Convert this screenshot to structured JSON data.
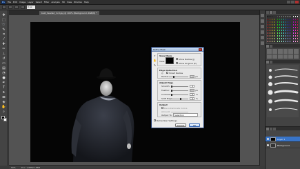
{
  "menubar": {
    "logo": "Ps",
    "items": [
      "File",
      "Edit",
      "Image",
      "Layer",
      "Select",
      "Filter",
      "Analysis",
      "3D",
      "View",
      "Window",
      "Help"
    ]
  },
  "options": {
    "field_value": "0 px"
  },
  "document": {
    "tab_label": "bald_headed_m-8.jpg @ 100% (Background, RGB/8) *"
  },
  "status": {
    "zoom": "50%",
    "doc_size": "Doc: 1.83M/1.83M"
  },
  "dialog": {
    "title": "Refine Mask",
    "view_mode": "View Mode",
    "view_label": "View:",
    "show_radius": "Show Radius (J)",
    "show_original": "Show Original (P)",
    "edge_detection": "Edge Detection",
    "smart_radius": "Smart Radius",
    "radius_label": "Radius:",
    "radius_value": "1.0",
    "radius_unit": "px",
    "adjust_edge": "Adjust Edge",
    "smooth_label": "Smooth:",
    "smooth_value": "0",
    "feather_label": "Feather:",
    "feather_value": "0.0",
    "feather_unit": "px",
    "contrast_label": "Contrast:",
    "contrast_value": "0",
    "contrast_unit": "%",
    "shift_label": "Shift Edge:",
    "shift_value": "0",
    "shift_unit": "%",
    "output": "Output",
    "decontaminate": "Decontaminate Colors",
    "amount_label": "Amount:",
    "output_to_label": "Output To:",
    "output_to_value": "Selection",
    "remember": "Remember Settings",
    "cancel": "Cancel",
    "ok": "OK"
  },
  "layers": [
    {
      "name": "Layer 1"
    },
    {
      "name": "Background"
    }
  ],
  "accent": "#3874c8"
}
